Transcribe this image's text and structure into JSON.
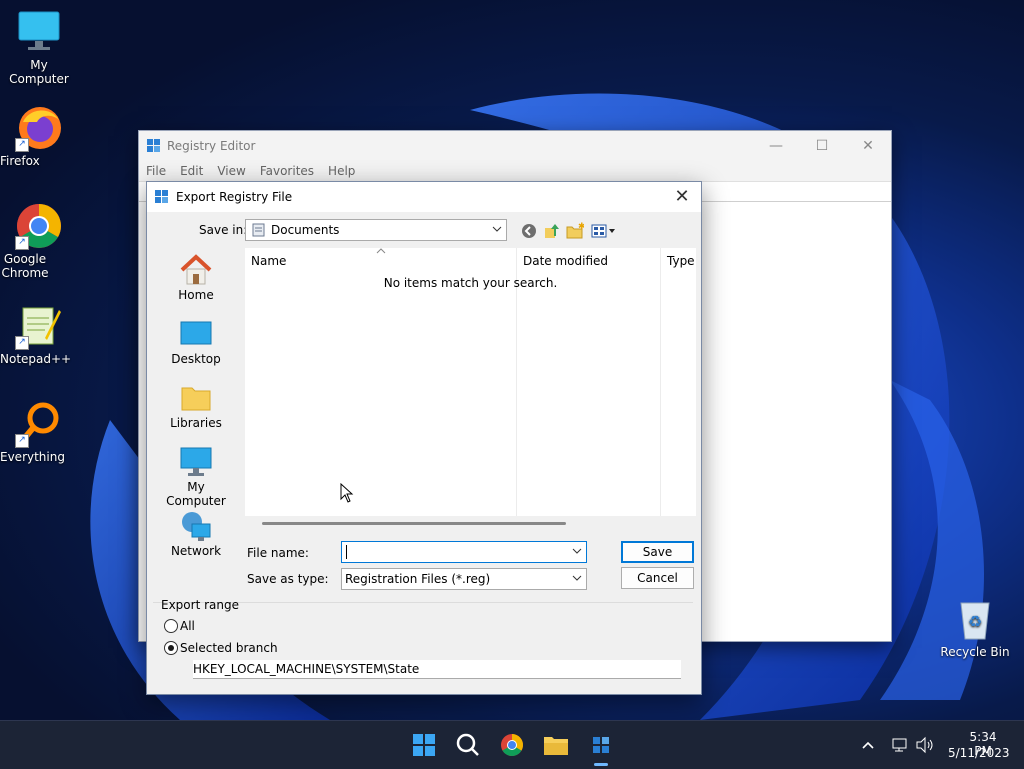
{
  "desktop": {
    "icons": [
      {
        "label": "My Computer",
        "icon": "monitor-icon"
      },
      {
        "label": "Firefox",
        "icon": "firefox-icon"
      },
      {
        "label": "Google Chrome",
        "icon": "chrome-icon"
      },
      {
        "label": "Notepad++",
        "icon": "notepadpp-icon"
      },
      {
        "label": "Everything",
        "icon": "search-magnifier-icon"
      }
    ],
    "recycle_bin": "Recycle Bin"
  },
  "registry_window": {
    "title": "Registry Editor",
    "menu": [
      "File",
      "Edit",
      "View",
      "Favorites",
      "Help"
    ]
  },
  "dialog": {
    "title": "Export Registry File",
    "save_in_label": "Save in:",
    "save_in_value": "Documents",
    "places": [
      "Home",
      "Desktop",
      "Libraries",
      "My Computer",
      "Network"
    ],
    "columns": [
      "Name",
      "Date modified",
      "Type"
    ],
    "empty_message": "No items match your search.",
    "file_name_label": "File name:",
    "file_name_value": "",
    "save_as_type_label": "Save as type:",
    "save_as_type_value": "Registration Files (*.reg)",
    "save_button": "Save",
    "cancel_button": "Cancel",
    "export_range_label": "Export range",
    "option_all": "All",
    "option_selected": "Selected branch",
    "selected_option": "Selected branch",
    "branch_path": "HKEY_LOCAL_MACHINE\\SYSTEM\\State"
  },
  "taskbar": {
    "time": "5:34 PM",
    "date": "5/11/2023"
  },
  "colors": {
    "accent": "#0078d7",
    "taskbar": "#1c2436"
  }
}
